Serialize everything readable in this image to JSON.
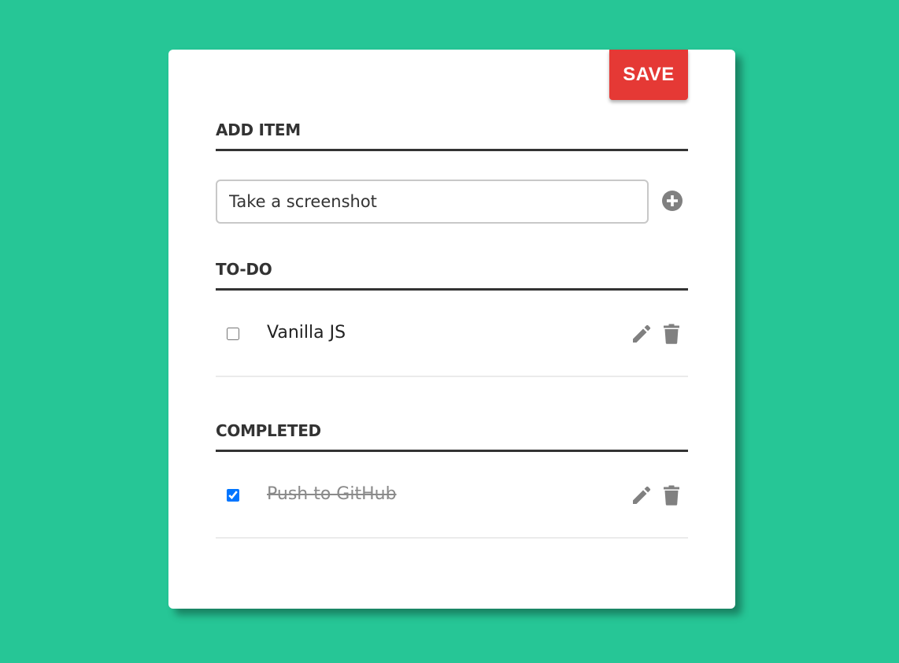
{
  "toolbar": {
    "save_label": "SAVE"
  },
  "add_section": {
    "title": "ADD ITEM",
    "input_value": "Take a screenshot",
    "add_icon": "plus-circle-icon"
  },
  "todo_section": {
    "title": "TO-DO",
    "items": [
      {
        "label": "Vanilla JS",
        "checked": false
      }
    ]
  },
  "completed_section": {
    "title": "COMPLETED",
    "items": [
      {
        "label": "Push to GitHub",
        "checked": true
      }
    ]
  },
  "icons": {
    "edit": "pencil-icon",
    "delete": "trash-icon"
  },
  "colors": {
    "background": "#26c696",
    "save_button": "#e53935",
    "icon_gray": "#808080",
    "text_dark": "#333333"
  }
}
